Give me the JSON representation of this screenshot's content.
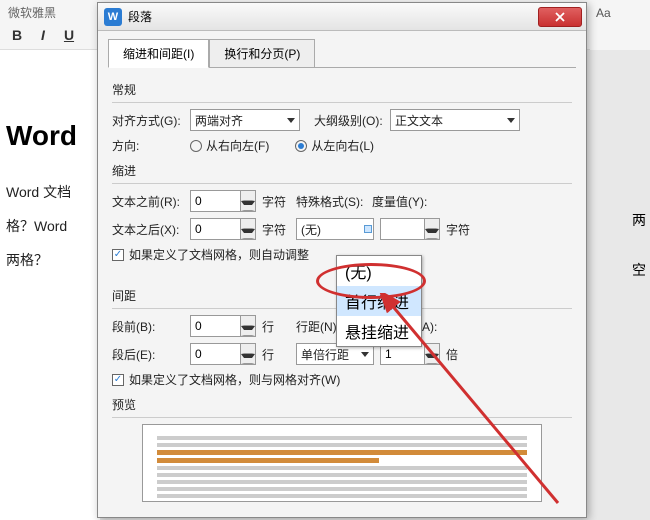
{
  "background": {
    "font_name": "微软雅黑",
    "format_bold": "B",
    "format_italic": "I",
    "format_underline": "U",
    "right_label": "Aa",
    "doc_title": "Word",
    "doc_line1": "Word 文档",
    "doc_line2": "格？Word",
    "doc_line3": "两格？",
    "trail1": "两",
    "trail2": "空"
  },
  "dialog": {
    "app_icon": "W",
    "title": "段落"
  },
  "tabs": {
    "active": "缩进和间距(I)",
    "other": "换行和分页(P)"
  },
  "general": {
    "label": "常规",
    "align_label": "对齐方式(G):",
    "align_value": "两端对齐",
    "outline_label": "大纲级别(O):",
    "outline_value": "正文文本",
    "direction_label": "方向:",
    "dir_rtl": "从右向左(F)",
    "dir_ltr": "从左向右(L)"
  },
  "indent": {
    "label": "缩进",
    "before_label": "文本之前(R):",
    "before_val": "0",
    "after_label": "文本之后(X):",
    "after_val": "0",
    "unit": "字符",
    "special_label": "特殊格式(S):",
    "special_value": "(无)",
    "measure_label": "度量值(Y):",
    "measure_unit": "字符",
    "check_grid": "如果定义了文档网格，则自动调整",
    "dropdown_opt0": "(无)",
    "dropdown_opt1": "首行缩进",
    "dropdown_opt2": "悬挂缩进"
  },
  "spacing": {
    "label": "间距",
    "before_label": "段前(B):",
    "before_val": "0",
    "after_label": "段后(E):",
    "after_val": "0",
    "unit": "行",
    "linespace_label": "行距(N):",
    "linespace_value": "单倍行距",
    "setval_label": "设置值(A):",
    "setval_val": "1",
    "setval_unit": "倍",
    "check_grid": "如果定义了文档网格，则与网格对齐(W)"
  },
  "preview": {
    "label": "预览"
  }
}
